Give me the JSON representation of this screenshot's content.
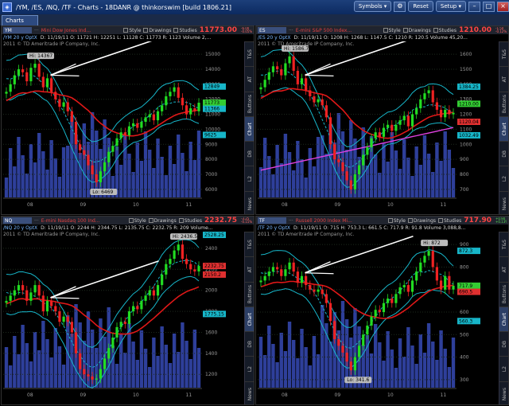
{
  "title": "/YM, /ES, /NQ, /TF - Charts - 18DANR @ thinkorswim [build 1806.21]",
  "title_right": {
    "symbols": "Symbols",
    "reset": "Reset",
    "setup": "Setup"
  },
  "main_tab": "Charts",
  "vtabs": [
    "News",
    "L2",
    "DB",
    "Chart",
    "Buttons",
    "AT",
    "T&S"
  ],
  "common": {
    "style": "Style",
    "drawings": "Drawings",
    "studies": "Studies",
    "copyright": "2011 © TD Ameritrade IP Company, Inc."
  },
  "panes": [
    {
      "symbol": "YM",
      "description": "Mini Dow Jones Ind...",
      "price": "11773.00",
      "change": "-6.00 -0.05%",
      "header": "/YM 20 y OptX",
      "ohlc": "D: 11/19/11  O: 11721  H: 12251  L: 11128  C: 11773  R: 1123  Volume 2,...",
      "y_ticks": [
        "15000",
        "14000",
        "13000",
        "12000",
        "11000",
        "10000",
        "9000",
        "8000",
        "7000",
        "6000"
      ],
      "x_ticks": [
        "08",
        "09",
        "10",
        "11"
      ],
      "hi": "Hi: 14367",
      "lo": "Lo: 6469",
      "bubbles": [
        {
          "text": "12849",
          "color": "#17b6c9",
          "v": 12849
        },
        {
          "text": "11773",
          "color": "#33cc33",
          "v": 11773
        },
        {
          "text": "11366",
          "color": "#17b6c9",
          "v": 11366
        },
        {
          "text": "9625",
          "color": "#17b6c9",
          "v": 9625
        }
      ],
      "series": [
        12500,
        13000,
        13600,
        14000,
        13800,
        13200,
        14100,
        14367,
        13500,
        12800,
        13400,
        12500,
        12000,
        11500,
        11800,
        11200,
        10500,
        9000,
        8600,
        8300,
        7600,
        7000,
        6469,
        7200,
        7800,
        8500,
        8900,
        9400,
        9800,
        9600,
        10200,
        10400,
        10100,
        10500,
        10800,
        11000,
        10600,
        11200,
        11600,
        12200,
        12500,
        12800,
        12100,
        11600,
        11000,
        11400,
        11200,
        11773
      ]
    },
    {
      "symbol": "ES",
      "description": "E-mini S&P 500 Index...",
      "price": "1210.00",
      "change": "-1.50 -0.12%",
      "header": "/ES 20 y OptX",
      "ohlc": "D: 11/19/11  O: 1208  H: 1268  L: 1147.5  C: 1210  R: 120.5  Volume 45,20...",
      "y_ticks": [
        "1600",
        "1500",
        "1400",
        "1300",
        "1200",
        "1100",
        "1000",
        "900",
        "800",
        "700"
      ],
      "x_ticks": [
        "08",
        "09",
        "10",
        "11"
      ],
      "hi": "Hi: 1586.75",
      "lo": "",
      "bubbles": [
        {
          "text": "1384.25",
          "color": "#17b6c9",
          "v": 1384
        },
        {
          "text": "1210.00",
          "color": "#33cc33",
          "v": 1270
        },
        {
          "text": "1120.04",
          "color": "#e03030",
          "v": 1150
        },
        {
          "text": "1032.49",
          "color": "#17b6c9",
          "v": 1060
        }
      ],
      "series": [
        1380,
        1430,
        1480,
        1520,
        1500,
        1460,
        1540,
        1586,
        1490,
        1400,
        1440,
        1360,
        1320,
        1280,
        1300,
        1260,
        1180,
        1000,
        900,
        880,
        820,
        760,
        700,
        800,
        860,
        930,
        980,
        1040,
        1080,
        1050,
        1110,
        1130,
        1090,
        1130,
        1160,
        1190,
        1120,
        1200,
        1240,
        1300,
        1340,
        1360,
        1280,
        1230,
        1180,
        1230,
        1200,
        1210
      ]
    },
    {
      "symbol": "NQ",
      "description": "E-mini Nasdaq 100 Ind...",
      "price": "2232.75",
      "change": "-3.25 -0.15%",
      "header": "/NQ 20 y OptX",
      "ohlc": "D: 11/19/11  O: 2244  H: 2344.75  L: 2135.75  C: 2232.75  R: 209  Volume...",
      "y_ticks": [
        "2400",
        "2200",
        "2000",
        "1800",
        "1600",
        "1400",
        "1200"
      ],
      "x_ticks": [
        "08",
        "09",
        "10",
        "11"
      ],
      "hi": "Hi: 2436.5",
      "lo": "",
      "bubbles": [
        {
          "text": "2528.25",
          "color": "#17b6c9",
          "v": 2528
        },
        {
          "text": "2232.75",
          "color": "#e03030",
          "v": 2232
        },
        {
          "text": "2150.2",
          "color": "#e03030",
          "v": 2150
        },
        {
          "text": "1775.15",
          "color": "#17b6c9",
          "v": 1775
        }
      ],
      "series": [
        1900,
        1950,
        2000,
        2050,
        2000,
        1900,
        1980,
        2050,
        1950,
        1800,
        1900,
        1850,
        1800,
        1700,
        1750,
        1700,
        1600,
        1400,
        1250,
        1200,
        1180,
        1150,
        1160,
        1250,
        1350,
        1450,
        1550,
        1650,
        1700,
        1680,
        1800,
        1850,
        1820,
        1900,
        1950,
        2000,
        1950,
        2050,
        2150,
        2250,
        2300,
        2380,
        2436,
        2300,
        2250,
        2200,
        2180,
        2232
      ]
    },
    {
      "symbol": "TF",
      "description": "Russell 2000 Index Mi...",
      "price": "717.90",
      "change": "+0.90 +0.13%",
      "header": "/TF 20 y OptX",
      "ohlc": "D: 11/19/11  O: 715  H: 753.3  L: 661.5  C: 717.9  R: 91.8  Volume 3,088,8...",
      "y_ticks": [
        "900",
        "800",
        "700",
        "600",
        "500",
        "400",
        "300"
      ],
      "x_ticks": [
        "08",
        "09",
        "10",
        "11"
      ],
      "hi": "Hi: 872",
      "lo": "Lo: 341.6",
      "bubbles": [
        {
          "text": "872.3",
          "color": "#17b6c9",
          "v": 872
        },
        {
          "text": "717.9",
          "color": "#33cc33",
          "v": 717
        },
        {
          "text": "690.5",
          "color": "#e03030",
          "v": 690
        },
        {
          "text": "560.3",
          "color": "#17b6c9",
          "v": 560
        }
      ],
      "series": [
        740,
        760,
        780,
        800,
        790,
        760,
        790,
        820,
        780,
        730,
        760,
        720,
        700,
        690,
        700,
        680,
        640,
        560,
        480,
        450,
        420,
        380,
        341,
        400,
        450,
        500,
        540,
        580,
        610,
        600,
        640,
        660,
        640,
        680,
        710,
        720,
        690,
        740,
        780,
        820,
        850,
        872,
        800,
        740,
        700,
        760,
        700,
        717
      ]
    }
  ]
}
